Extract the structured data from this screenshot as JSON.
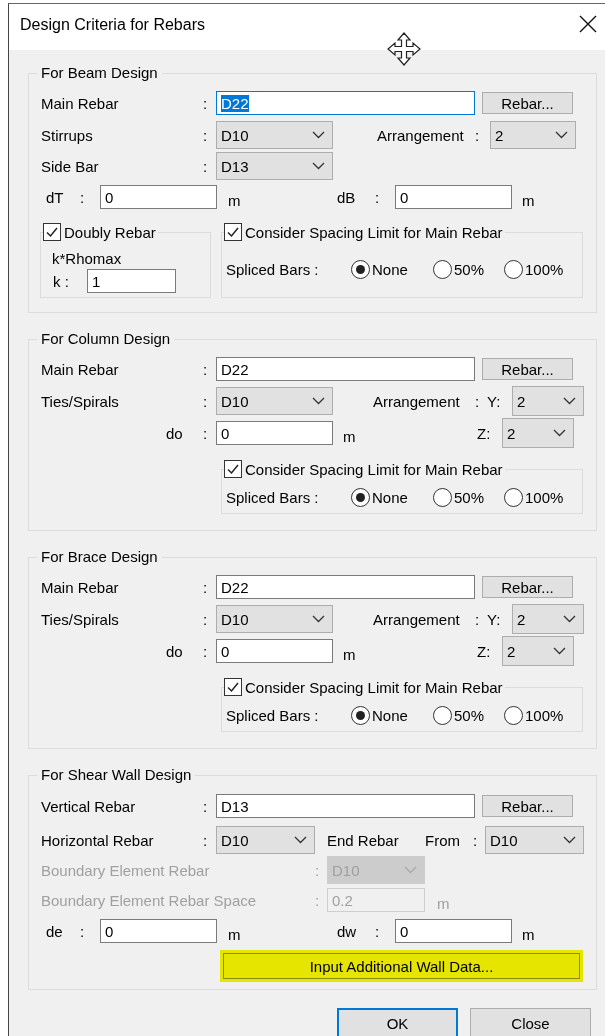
{
  "window": {
    "title": "Design Criteria for Rebars"
  },
  "beam": {
    "title": "For Beam Design",
    "main_rebar": {
      "label": "Main Rebar",
      "colon": ":",
      "value": "D22",
      "focused": true
    },
    "rebar_button": "Rebar...",
    "stirrups": {
      "label": "Stirrups",
      "colon": ":",
      "value": "D10"
    },
    "arrangement": {
      "label": "Arrangement",
      "colon": ":",
      "value": "2"
    },
    "side_bar": {
      "label": "Side Bar",
      "colon": ":",
      "value": "D13"
    },
    "dt": {
      "label": "dT",
      "colon": ":",
      "value": "0",
      "unit": "m"
    },
    "db": {
      "label": "dB",
      "colon": ":",
      "value": "0",
      "unit": "m"
    },
    "doubly_rebar": {
      "label": "Doubly Rebar",
      "checked": true
    },
    "k_caption": "k*Rhomax",
    "k": {
      "label": "k :",
      "value": "1"
    },
    "spacing_limit": {
      "label": "Consider Spacing Limit for Main Rebar",
      "checked": true
    },
    "spliced_bars": {
      "label": "Spliced Bars :",
      "options": [
        {
          "label": "None",
          "selected": true
        },
        {
          "label": "50%",
          "selected": false
        },
        {
          "label": "100%",
          "selected": false
        }
      ]
    }
  },
  "column": {
    "title": "For Column Design",
    "main_rebar": {
      "label": "Main Rebar",
      "colon": ":",
      "value": "D22",
      "focused": false
    },
    "rebar_button": "Rebar...",
    "ties": {
      "label": "Ties/Spirals",
      "colon": ":",
      "value": "D10"
    },
    "arrangement": {
      "label": "Arrangement",
      "colon": ":",
      "y_label": "Y:",
      "y_value": "2",
      "z_label": "Z:",
      "z_value": "2"
    },
    "do": {
      "label": "do",
      "colon": ":",
      "value": "0",
      "unit": "m"
    },
    "spacing_limit": {
      "label": "Consider Spacing Limit for Main Rebar",
      "checked": true
    },
    "spliced_bars": {
      "label": "Spliced Bars :",
      "options": [
        {
          "label": "None",
          "selected": true
        },
        {
          "label": "50%",
          "selected": false
        },
        {
          "label": "100%",
          "selected": false
        }
      ]
    }
  },
  "brace": {
    "title": "For Brace Design",
    "main_rebar": {
      "label": "Main Rebar",
      "colon": ":",
      "value": "D22",
      "focused": false
    },
    "rebar_button": "Rebar...",
    "ties": {
      "label": "Ties/Spirals",
      "colon": ":",
      "value": "D10"
    },
    "arrangement": {
      "label": "Arrangement",
      "colon": ":",
      "y_label": "Y:",
      "y_value": "2",
      "z_label": "Z:",
      "z_value": "2"
    },
    "do": {
      "label": "do",
      "colon": ":",
      "value": "0",
      "unit": "m"
    },
    "spacing_limit": {
      "label": "Consider Spacing Limit for Main Rebar",
      "checked": true
    },
    "spliced_bars": {
      "label": "Spliced Bars :",
      "options": [
        {
          "label": "None",
          "selected": true
        },
        {
          "label": "50%",
          "selected": false
        },
        {
          "label": "100%",
          "selected": false
        }
      ]
    }
  },
  "shear_wall": {
    "title": "For Shear Wall Design",
    "vertical_rebar": {
      "label": "Vertical Rebar",
      "colon": ":",
      "value": "D13",
      "focused": false
    },
    "rebar_button": "Rebar...",
    "horizontal_rebar": {
      "label": "Horizontal Rebar",
      "colon": ":",
      "value": "D10"
    },
    "end_rebar": {
      "label": "End Rebar",
      "from_label": "From",
      "colon": ":",
      "value": "D10"
    },
    "boundary_rebar": {
      "label": "Boundary Element Rebar",
      "colon": ":",
      "value": "D10",
      "disabled": true
    },
    "boundary_space": {
      "label": "Boundary Element Rebar Space",
      "colon": ":",
      "value": "0.2",
      "unit": "m",
      "disabled": true
    },
    "de": {
      "label": "de",
      "colon": ":",
      "value": "0",
      "unit": "m"
    },
    "dw": {
      "label": "dw",
      "colon": ":",
      "value": "0",
      "unit": "m"
    },
    "additional_button": {
      "label": "Input Additional Wall Data...",
      "highlighted": true
    }
  },
  "buttons": [
    {
      "label": "OK",
      "default": true
    },
    {
      "label": "Close",
      "default": false
    }
  ]
}
